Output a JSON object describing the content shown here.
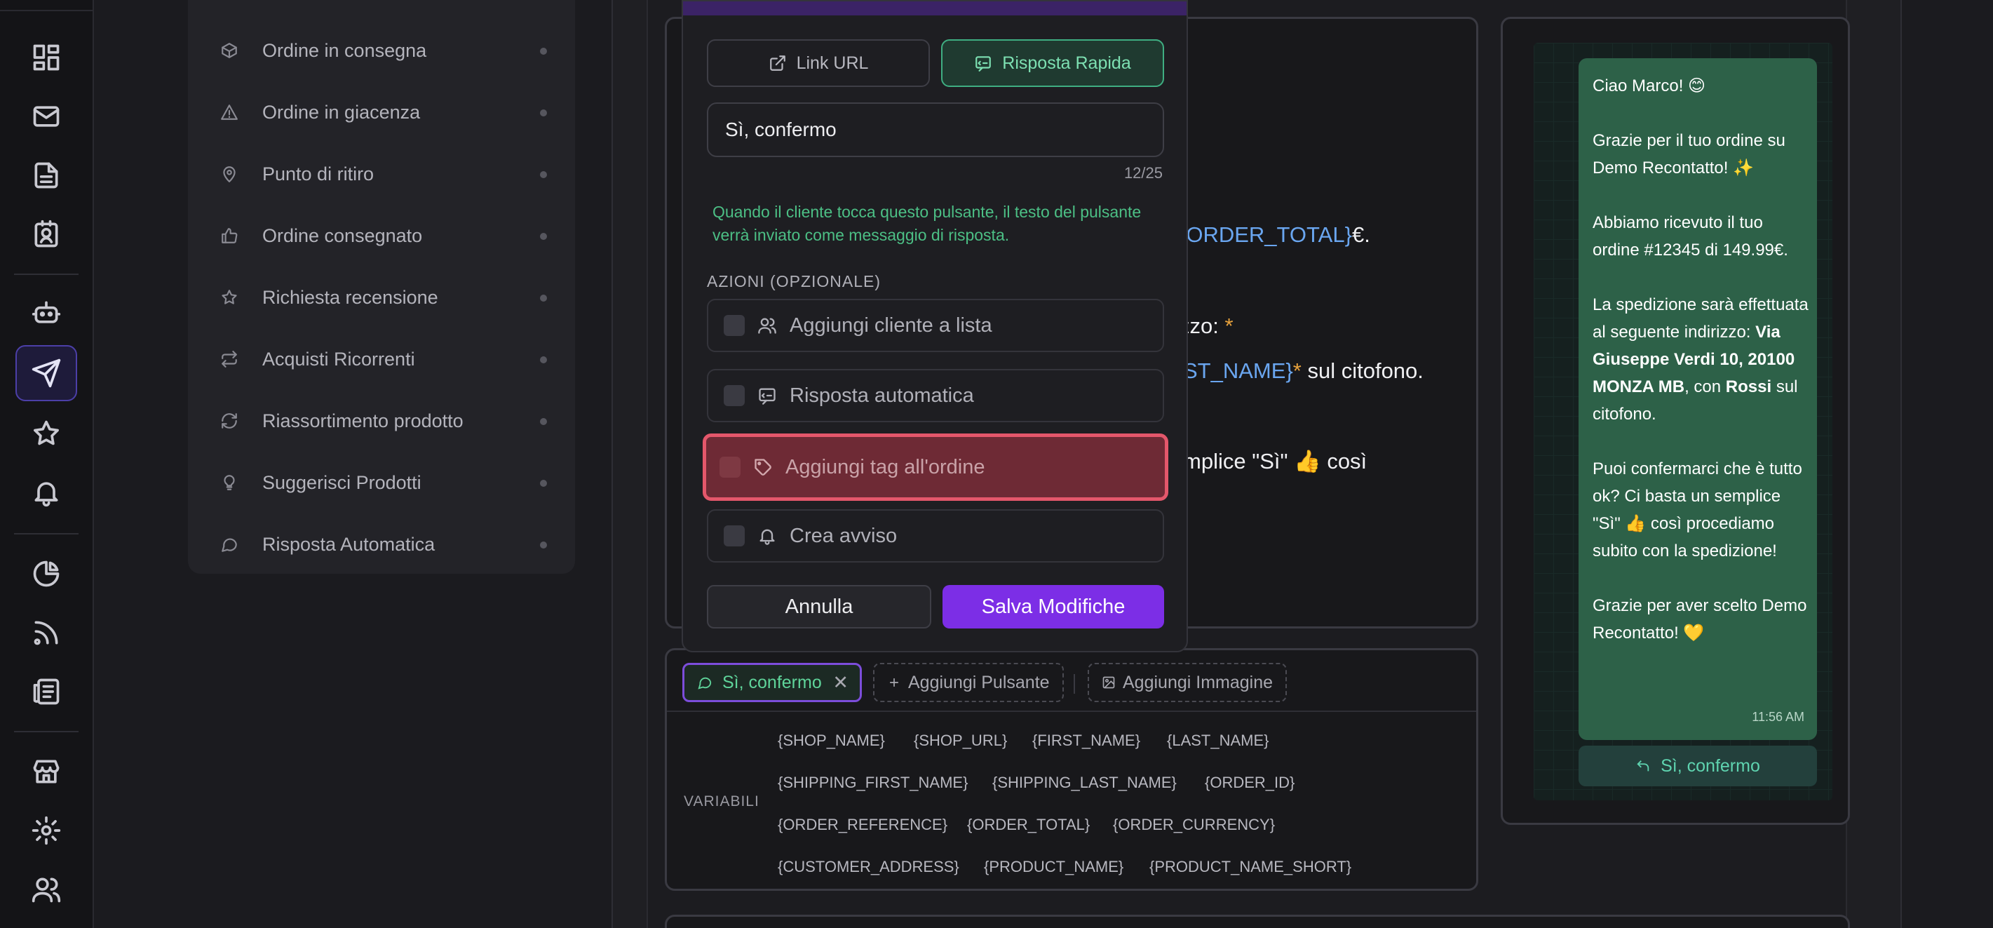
{
  "templates": [
    {
      "label": "Ordine in consegna",
      "icon": "package-icon"
    },
    {
      "label": "Ordine in giacenza",
      "icon": "warning-icon"
    },
    {
      "label": "Punto di ritiro",
      "icon": "map-pin-icon"
    },
    {
      "label": "Ordine consegnato",
      "icon": "thumbs-up-icon"
    },
    {
      "label": "Richiesta recensione",
      "icon": "star-icon"
    },
    {
      "label": "Acquisti Ricorrenti",
      "icon": "repeat-icon"
    },
    {
      "label": "Riassortimento prodotto",
      "icon": "refresh-icon"
    },
    {
      "label": "Suggerisci Prodotti",
      "icon": "lightbulb-icon"
    },
    {
      "label": "Risposta Automatica",
      "icon": "chat-icon"
    }
  ],
  "editor": {
    "line1_var": "{ORDER_TOTAL}",
    "line1_after": "€.",
    "line2_before": "zzo: ",
    "line2_ast": "*",
    "line3_var": "ST_NAME}",
    "line3_ast": "*",
    "line3_after": " sul citofono.",
    "line4": "mplice \"Sì\" 👍 così"
  },
  "buttons_row": {
    "active_chip": "Sì, confermo",
    "close": "✕",
    "add_button": "Aggiungi Pulsante",
    "add_image": "Aggiungi Immagine"
  },
  "variables": {
    "label": "VARIABILI",
    "rows": [
      [
        "{SHOP_NAME}",
        "{SHOP_URL}",
        "{FIRST_NAME}",
        "{LAST_NAME}"
      ],
      [
        "{SHIPPING_FIRST_NAME}",
        "{SHIPPING_LAST_NAME}",
        "{ORDER_ID}"
      ],
      [
        "{ORDER_REFERENCE}",
        "{ORDER_TOTAL}",
        "{ORDER_CURRENCY}"
      ],
      [
        "{CUSTOMER_ADDRESS}",
        "{PRODUCT_NAME}",
        "{PRODUCT_NAME_SHORT}"
      ]
    ]
  },
  "modal": {
    "type_link": "Link URL",
    "type_quick": "Risposta Rapida",
    "input_value": "Sì, confermo",
    "counter": "12/25",
    "hint": "Quando il cliente tocca questo pulsante, il testo del pulsante verrà inviato come messaggio di risposta.",
    "actions_label": "AZIONI (OPZIONALE)",
    "actions": [
      {
        "label": "Aggiungi cliente a lista",
        "icon": "users-icon"
      },
      {
        "label": "Risposta automatica",
        "icon": "chat-reply-icon"
      },
      {
        "label": "Aggiungi tag all'ordine",
        "icon": "tag-icon"
      },
      {
        "label": "Crea avviso",
        "icon": "bell-icon"
      }
    ],
    "cancel": "Annulla",
    "save": "Salva Modifiche"
  },
  "preview": {
    "p1": "Ciao Marco! 😊",
    "p2": "Grazie per il tuo ordine su Demo Recontatto! ✨",
    "p3": "Abbiamo ricevuto il tuo ordine #12345 di 149.99€.",
    "p4_a": "La spedizione sarà effettuata al seguente indirizzo: ",
    "p4_b": "Via Giuseppe Verdi 10, 20100 MONZA MB",
    "p4_c": ", con ",
    "p4_d": "Rossi",
    "p4_e": " sul citofono.",
    "p5": "Puoi confermarci che è tutto ok? Ci basta un semplice \"Sì\" 👍 così procediamo subito con la spedizione!",
    "p6": "Grazie per aver scelto Demo Recontatto! 💛",
    "time": "11:56 AM",
    "reply": "Sì, confermo"
  },
  "colors": {
    "accent": "#7c2ee6",
    "quick_reply_green": "#3fae82",
    "highlight_red": "#e4576b",
    "bubble": "#2d6148"
  }
}
